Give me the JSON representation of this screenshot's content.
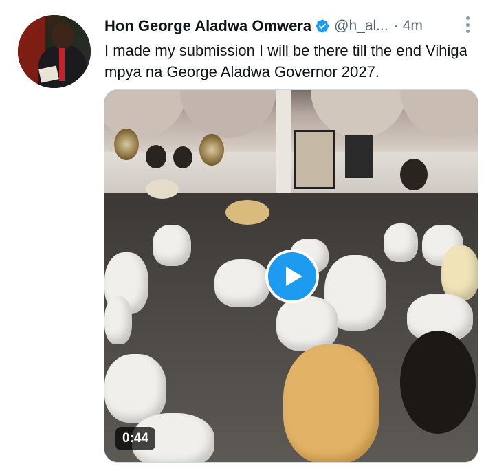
{
  "author": {
    "name": "Hon George Aladwa Omwera",
    "handle": "@h_al...",
    "separator": "·",
    "time": "4m",
    "verified": true
  },
  "tweet": {
    "text": "I made my submission I will be there till the end Vihiga mpya na George Aladwa Governor 2027."
  },
  "media": {
    "type": "video",
    "duration": "0:44",
    "play_icon": "play-icon"
  },
  "icons": {
    "verified": "verified-badge-icon",
    "more": "more-options-icon"
  },
  "colors": {
    "accent": "#1d9bf0",
    "secondary_text": "#536471",
    "primary_text": "#0f1419",
    "background": "#ffffff"
  }
}
